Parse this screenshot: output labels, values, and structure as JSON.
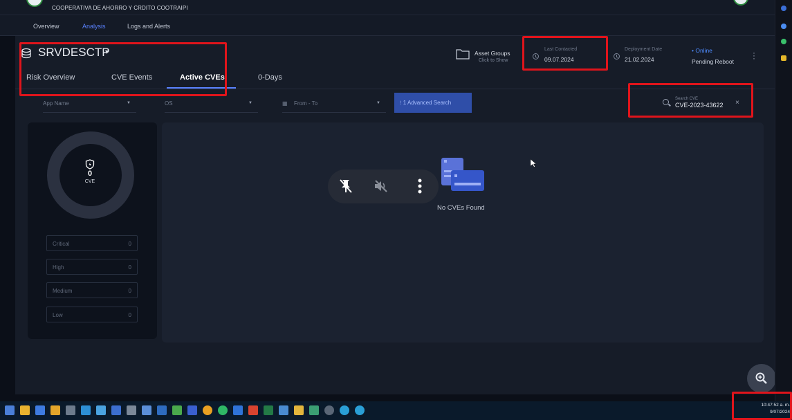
{
  "header": {
    "org_name": "COOPERATIVA DE AHORRO Y CRDITO COOTRAIPI",
    "nav": [
      "Overview",
      "Analysis",
      "Logs and Alerts"
    ],
    "active_nav": "Analysis"
  },
  "device": {
    "name": "SRVDESCTP",
    "caret": "▾",
    "tabs": [
      "Risk Overview",
      "CVE Events",
      "Active CVEs",
      "0-Days"
    ],
    "active_tab": "Active CVEs"
  },
  "info": {
    "asset_groups_title": "Asset Groups",
    "asset_groups_sub": "Click to Show",
    "last_contacted_label": "Last Contacted",
    "last_contacted_value": "09.07.2024",
    "deployment_label": "Deployment Date",
    "deployment_value": "21.02.2024",
    "status_online": "• Online",
    "status_reboot": "Pending Reboot"
  },
  "filters": {
    "app_name": "App Name",
    "os": "OS",
    "date_range": "From - To",
    "advanced_search": "⁝ 1 Advanced Search",
    "search_label": "Search CVE",
    "search_value": "CVE-2023-43622",
    "clear": "×"
  },
  "summary": {
    "count": "0",
    "count_label": "CVE",
    "severities": [
      {
        "label": "Critical",
        "value": "0"
      },
      {
        "label": "High",
        "value": "0"
      },
      {
        "label": "Medium",
        "value": "0"
      },
      {
        "label": "Low",
        "value": "0"
      }
    ]
  },
  "results": {
    "empty_message": "No CVEs Found"
  },
  "taskbar": {
    "time": "10:47:52 a. m.",
    "date": "9/07/2024"
  },
  "colors": {
    "accent": "#5a82ff",
    "highlight": "#e0141b",
    "panel": "#161c28"
  }
}
